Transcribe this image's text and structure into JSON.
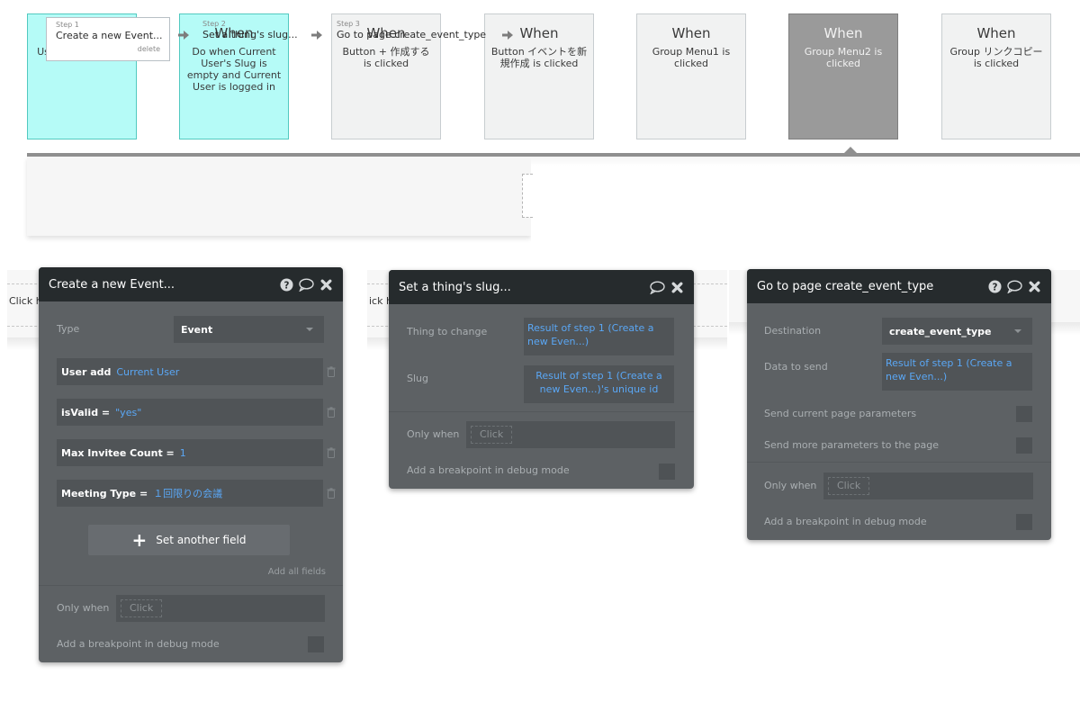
{
  "events": [
    {
      "when": "When",
      "description": "User is logged out",
      "style": "cyan"
    },
    {
      "when": "When",
      "description": "Do when Current User's Slug is empty and Current User is logged in",
      "style": "cyan"
    },
    {
      "when": "When",
      "description": "Button + 作成する is clicked",
      "style": "normal"
    },
    {
      "when": "When",
      "description": "Button イベントを新規作成 is clicked",
      "style": "normal"
    },
    {
      "when": "When",
      "description": "Group Menu1 is clicked",
      "style": "normal"
    },
    {
      "when": "When",
      "description": "Group Menu2 is clicked",
      "style": "active"
    },
    {
      "when": "When",
      "description": "Group リンクコピー is clicked",
      "style": "normal"
    }
  ],
  "steps": [
    {
      "number": "Step 1",
      "title": "Create a new Event...",
      "delete": "delete"
    },
    {
      "number": "Step 2",
      "title": "Set a thing's slug..."
    },
    {
      "number": "Step 3",
      "title": "Go to page create_event_type"
    }
  ],
  "background_peek": {
    "left": "Click h",
    "middle": "ick h"
  },
  "panel_create": {
    "title": "Create a new Event...",
    "type_label": "Type",
    "type_value": "Event",
    "fields": [
      {
        "name": "User add",
        "value": "Current User"
      },
      {
        "name": "isValid  =",
        "value": "\"yes\""
      },
      {
        "name": "Max Invitee Count  =",
        "value": "1"
      },
      {
        "name": "Meeting Type  =",
        "value": "１回限りの会議"
      }
    ],
    "set_another_field": "Set another field",
    "add_all_fields": "Add all fields",
    "only_when": "Only when",
    "click_placeholder": "Click",
    "breakpoint": "Add a breakpoint in debug mode"
  },
  "panel_slug": {
    "title": "Set a thing's slug...",
    "thing_label": "Thing to change",
    "thing_value": "Result of step 1 (Create a new Even...)",
    "slug_label": "Slug",
    "slug_value": "Result of step 1 (Create a new Even...)'s unique id",
    "only_when": "Only when",
    "click_placeholder": "Click",
    "breakpoint": "Add a breakpoint in debug mode"
  },
  "panel_goto": {
    "title": "Go to page create_event_type",
    "destination_label": "Destination",
    "destination_value": "create_event_type",
    "data_label": "Data to send",
    "data_value": "Result of step 1 (Create a new Even...)",
    "send_current": "Send current page parameters",
    "send_more": "Send more parameters to the page",
    "only_when": "Only when",
    "click_placeholder": "Click",
    "breakpoint": "Add a breakpoint in debug mode"
  },
  "colors": {
    "cyan_card": "#b5fbf7",
    "active_card": "#9a9a9a",
    "panel_bg": "#5d6164",
    "panel_header": "#262b2d",
    "expression_blue": "#5aa7f5"
  }
}
